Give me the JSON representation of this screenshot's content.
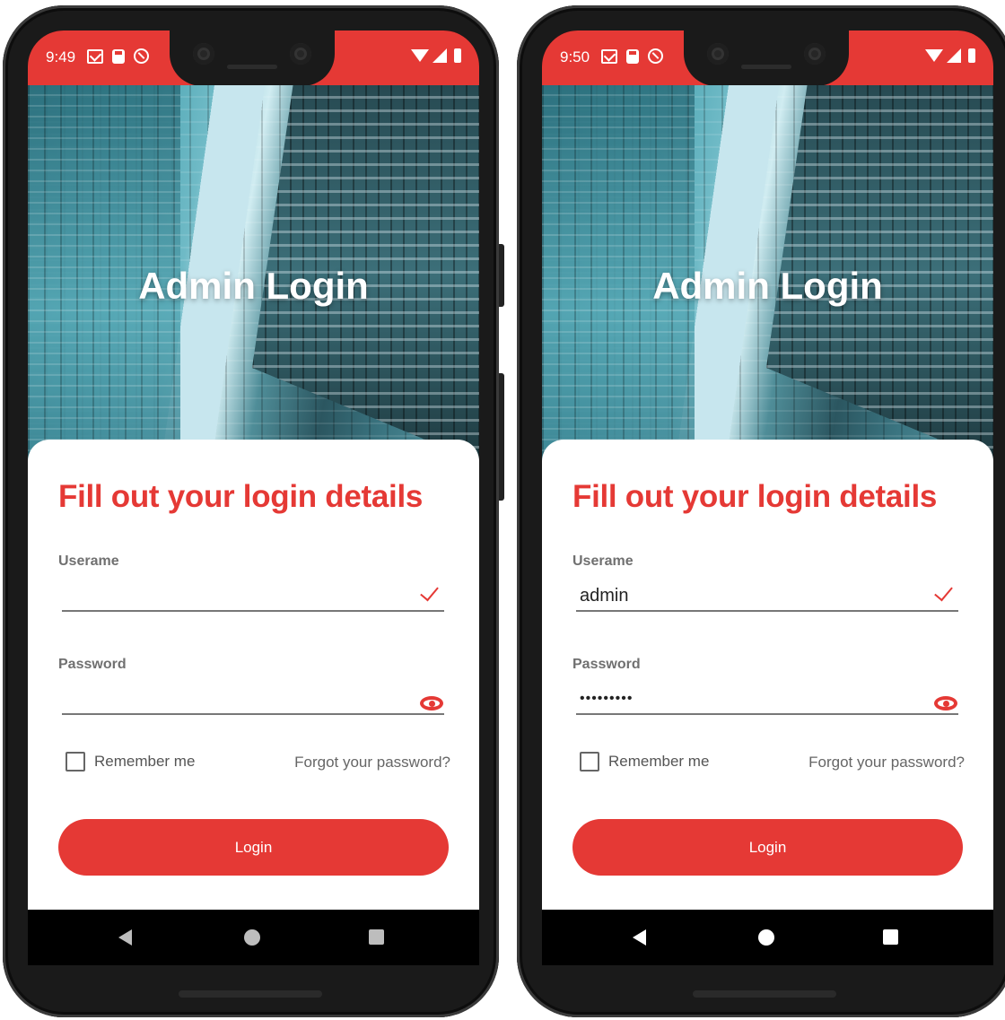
{
  "screens": [
    {
      "status_time": "9:49",
      "hero_title": "Admin Login",
      "heading": "Fill out your login details",
      "username_label": "Userame",
      "username_value": "",
      "password_label": "Password",
      "password_value": "",
      "remember_label": "Remember me",
      "forgot_label": "Forgot your password?",
      "login_label": "Login"
    },
    {
      "status_time": "9:50",
      "hero_title": "Admin Login",
      "heading": "Fill out your login details",
      "username_label": "Userame",
      "username_value": "admin",
      "password_label": "Password",
      "password_value": "•••••••••",
      "remember_label": "Remember me",
      "forgot_label": "Forgot your password?",
      "login_label": "Login"
    }
  ],
  "colors": {
    "accent": "#e53935",
    "text_muted": "#707070"
  },
  "icons": [
    "mail-icon",
    "sd-card-icon",
    "do-not-disturb-icon",
    "wifi-icon",
    "signal-icon",
    "battery-icon",
    "checkmark-icon",
    "eye-icon",
    "back-icon",
    "home-icon",
    "recents-icon"
  ]
}
